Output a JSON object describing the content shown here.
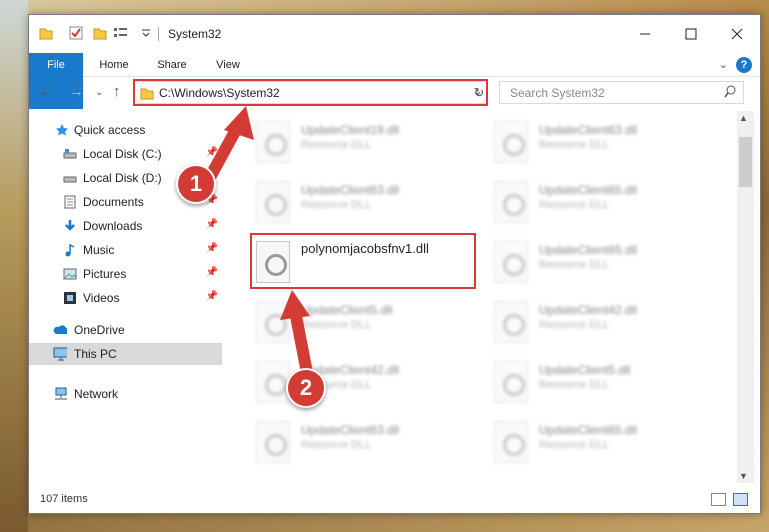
{
  "window": {
    "title": "System32"
  },
  "ribbon": {
    "tabs": [
      "File",
      "Home",
      "Share",
      "View"
    ],
    "help": "?"
  },
  "address": {
    "path": "C:\\Windows\\System32"
  },
  "search": {
    "placeholder": "Search System32"
  },
  "sidebar": {
    "items": [
      {
        "label": "Quick access"
      },
      {
        "label": "Local Disk (C:)"
      },
      {
        "label": "Local Disk (D:)"
      },
      {
        "label": "Documents"
      },
      {
        "label": "Downloads"
      },
      {
        "label": "Music"
      },
      {
        "label": "Pictures"
      },
      {
        "label": "Videos"
      },
      {
        "label": "OneDrive"
      },
      {
        "label": "This PC"
      },
      {
        "label": "Network"
      }
    ]
  },
  "files": [
    {
      "name": "UpdateClient19.dll",
      "type": "Resource DLL"
    },
    {
      "name": "UpdateClient63.dll",
      "type": "Resource DLL"
    },
    {
      "name": "UpdateClient63.dll",
      "type": "Resource DLL"
    },
    {
      "name": "UpdateClient65.dll",
      "type": "Resource DLL"
    },
    {
      "name": "polynomjacobsfnv1.dll",
      "type": ""
    },
    {
      "name": "UpdateClient65.dll",
      "type": "Resource DLL"
    },
    {
      "name": "UpdateClient5.dll",
      "type": "Resource DLL"
    },
    {
      "name": "UpdateClient42.dll",
      "type": "Resource DLL"
    },
    {
      "name": "UpdateClient42.dll",
      "type": "Resource DLL"
    },
    {
      "name": "UpdateClient5.dll",
      "type": "Resource DLL"
    },
    {
      "name": "UpdateClient63.dll",
      "type": "Resource DLL"
    },
    {
      "name": "UpdateClient65.dll",
      "type": "Resource DLL"
    }
  ],
  "status": {
    "count": "107 items"
  },
  "callouts": {
    "one": "1",
    "two": "2"
  },
  "colors": {
    "accent": "#1979ca",
    "highlight": "#d9393a",
    "badge": "#d33c34"
  }
}
